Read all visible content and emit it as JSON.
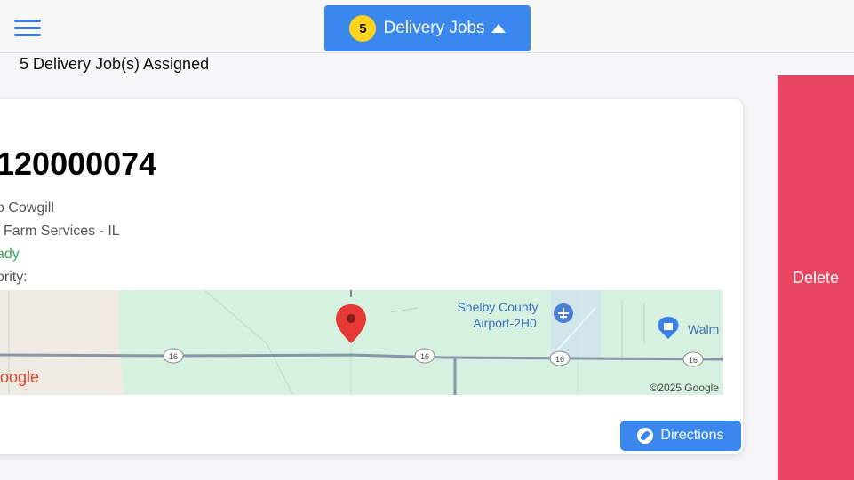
{
  "header": {
    "jobs_count": "5",
    "jobs_label": "Delivery Jobs",
    "assigned_text": "5 Delivery Job(s) Assigned"
  },
  "job": {
    "number": "120000074",
    "line1": "o Cowgill",
    "line2": "l Farm Services - IL",
    "status": "ady",
    "priority": "ority:"
  },
  "map": {
    "poi_name": "Shelby County Airport-2H0",
    "poi_line1": "Shelby County",
    "poi_line2": "Airport-2H0",
    "store_label": "Walm",
    "copyright": "©2025 Google",
    "logo_partial": "oogle",
    "route_label": "16"
  },
  "actions": {
    "directions_label": "Directions",
    "delete_label": "Delete"
  },
  "colors": {
    "accent": "#3a87ee",
    "badge": "#ffd320",
    "delete": "#e94560",
    "status": "#3ba55c"
  }
}
